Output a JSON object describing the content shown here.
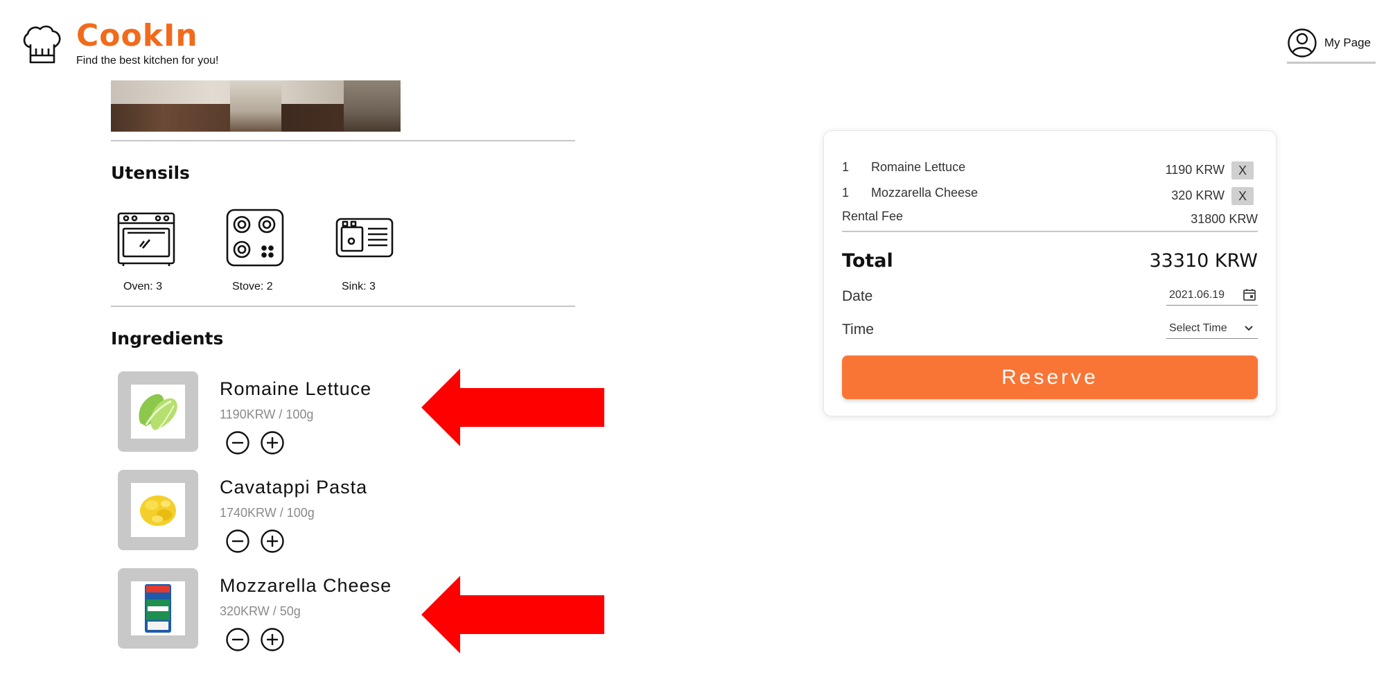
{
  "header": {
    "brand": "CookIn",
    "tagline": "Find the best kitchen for you!",
    "my_page": "My Page"
  },
  "sections": {
    "utensils_title": "Utensils",
    "ingredients_title": "Ingredients"
  },
  "utensils": [
    {
      "label": "Oven: 3",
      "icon": "oven-icon"
    },
    {
      "label": "Stove: 2",
      "icon": "stove-icon"
    },
    {
      "label": "Sink: 3",
      "icon": "sink-icon"
    }
  ],
  "ingredients": [
    {
      "name": "Romaine Lettuce",
      "price": "1190KRW / 100g",
      "highlighted": true
    },
    {
      "name": "Cavatappi Pasta",
      "price": "1740KRW / 100g",
      "highlighted": false
    },
    {
      "name": "Mozzarella Cheese",
      "price": "320KRW / 50g",
      "highlighted": true
    }
  ],
  "order": {
    "items": [
      {
        "qty": "1",
        "name": "Romaine Lettuce",
        "price": "1190 KRW",
        "remove": "X"
      },
      {
        "qty": "1",
        "name": "Mozzarella Cheese",
        "price": "320 KRW",
        "remove": "X"
      }
    ],
    "rental_fee_label": "Rental Fee",
    "rental_fee": "31800 KRW",
    "total_label": "Total",
    "total": "33310 KRW",
    "date_label": "Date",
    "date_value": "2021.06.19",
    "time_label": "Time",
    "time_value": "Select Time",
    "reserve_label": "Reserve"
  },
  "colors": {
    "brand": "#f26a1b",
    "reserve_button": "#f97535",
    "arrow": "#ff0000",
    "thumb_bg": "#c8c8c8"
  }
}
